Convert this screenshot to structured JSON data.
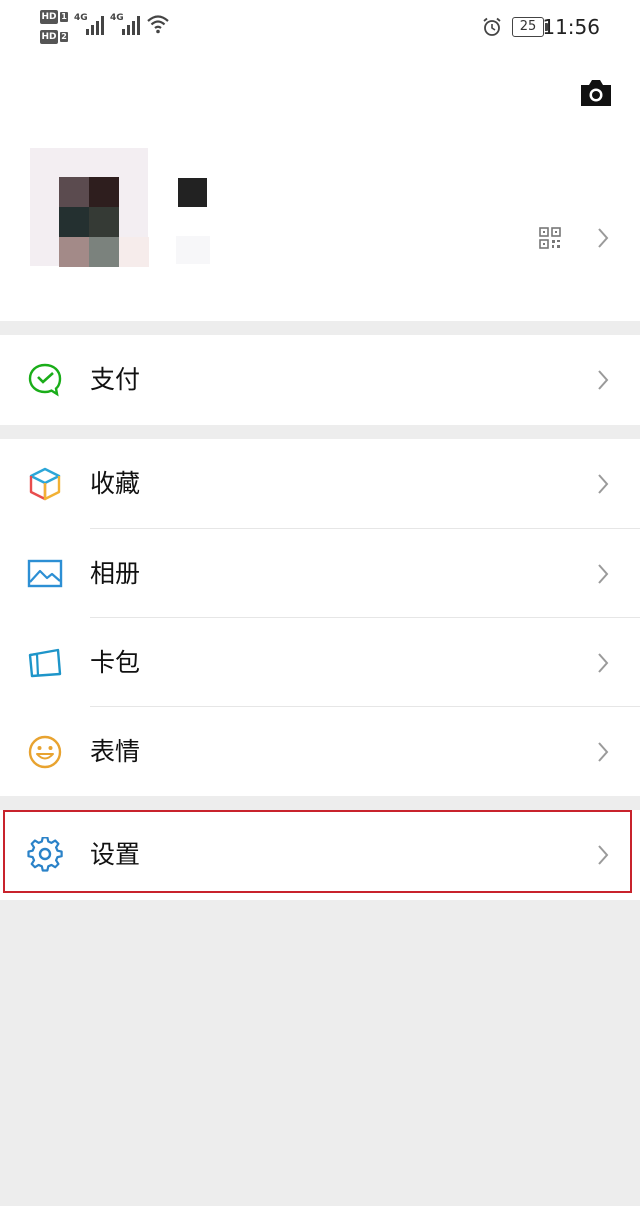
{
  "status_bar": {
    "hd1": "HD",
    "hd1_num": "1",
    "hd2": "HD",
    "hd2_num": "2",
    "net1": "4G",
    "net2": "4G",
    "battery": "25",
    "time": "11:56"
  },
  "menu": {
    "pay": "支付",
    "favorites": "收藏",
    "album": "相册",
    "cards": "卡包",
    "stickers": "表情",
    "settings": "设置"
  },
  "colors": {
    "pay_icon": "#1aad19",
    "album_icon": "#2c8fd4",
    "cards_icon": "#1e95c9",
    "stickers_icon": "#e8a330",
    "settings_icon": "#2a82c8",
    "highlight_border": "#c8232c"
  },
  "icons": {
    "header": [
      "camera-icon",
      "qr-code-icon",
      "chevron-right-icon"
    ],
    "rows": [
      "wechat-pay-icon",
      "favorites-cube-icon",
      "album-picture-icon",
      "card-wallet-icon",
      "smiley-sticker-icon",
      "settings-gear-icon"
    ]
  }
}
